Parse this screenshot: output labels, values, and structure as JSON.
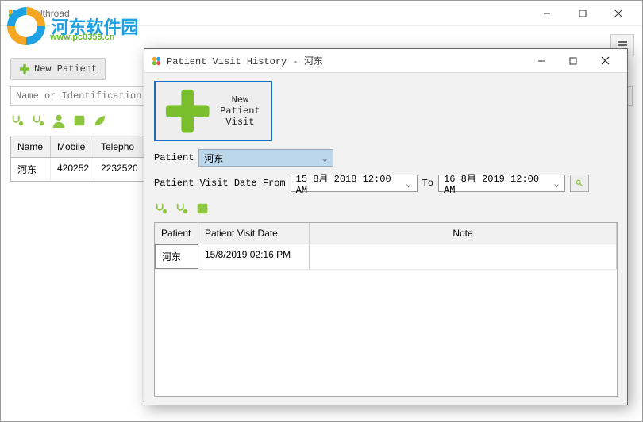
{
  "main_window": {
    "title": "Healthroad",
    "hamburger_label": "menu"
  },
  "watermark": {
    "text": "河东软件园",
    "sub": "www.pc0359.cn"
  },
  "main": {
    "new_patient_label": "New Patient",
    "search_placeholder": "Name or Identification N",
    "toolbar": [
      "link1",
      "link2",
      "person",
      "book",
      "leaf"
    ]
  },
  "patient_grid": {
    "columns": [
      "Name",
      "Mobile",
      "Telepho"
    ],
    "rows": [
      {
        "name": "河东",
        "mobile": "420252",
        "telephone": "2232520"
      }
    ]
  },
  "modal": {
    "title": "Patient Visit History - 河东",
    "new_visit_label": "New Patient Visit",
    "patient_label": "Patient",
    "patient_value": "河东",
    "date_from_label": "Patient Visit Date From",
    "date_from_value": "15 8月 2018 12:00 AM",
    "date_to_label": "To",
    "date_to_value": "16 8月 2019 12:00 AM",
    "toolbar": [
      "link1",
      "link2",
      "book"
    ]
  },
  "visit_grid": {
    "columns": {
      "patient": "Patient",
      "visit_date": "Patient Visit Date",
      "note": "Note"
    },
    "rows": [
      {
        "patient": "河东",
        "visit_date": "15/8/2019 02:16 PM",
        "note": ""
      }
    ]
  }
}
